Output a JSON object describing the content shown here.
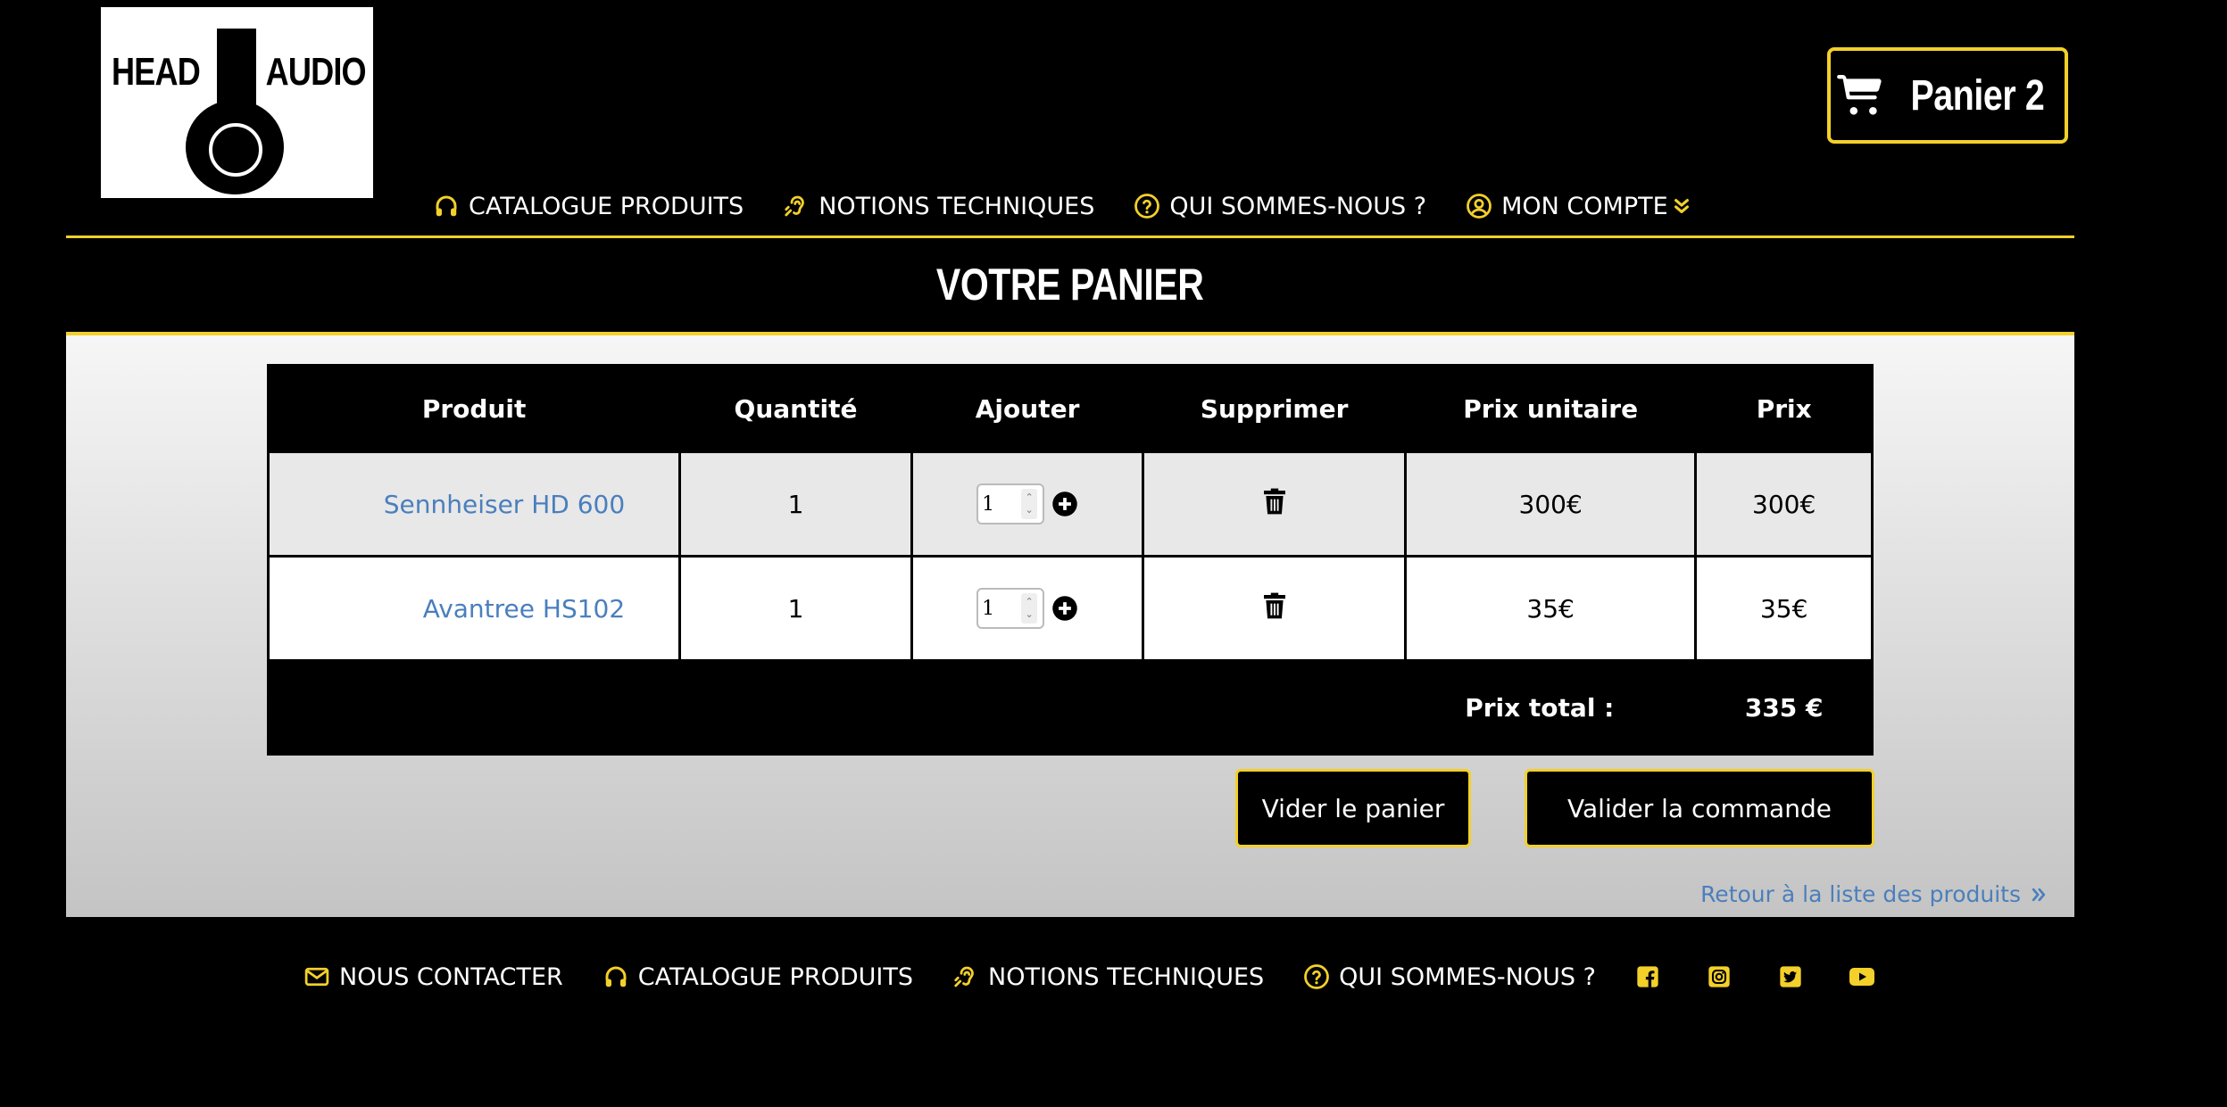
{
  "brand": {
    "word1": "HEAD",
    "word2": "AUDIO"
  },
  "cart_button": {
    "label": "Panier 2",
    "icon": "cart-icon"
  },
  "nav": [
    {
      "label": "CATALOGUE PRODUITS",
      "icon": "headphones-icon"
    },
    {
      "label": "NOTIONS TECHNIQUES",
      "icon": "ear-icon"
    },
    {
      "label": "QUI SOMMES-NOUS ?",
      "icon": "question-circle-icon"
    },
    {
      "label": "MON COMPTE",
      "icon": "user-circle-icon",
      "trailing_icon": "double-chevron-down-icon"
    }
  ],
  "page_title": "VOTRE PANIER",
  "table": {
    "headers": [
      "Produit",
      "Quantité",
      "Ajouter",
      "Supprimer",
      "Prix unitaire",
      "Prix"
    ],
    "rows": [
      {
        "product": "Sennheiser HD 600",
        "quantity": "1",
        "add_value": "1",
        "unit_price": "300€",
        "price": "300€"
      },
      {
        "product": "Avantree HS102",
        "quantity": "1",
        "add_value": "1",
        "unit_price": "35€",
        "price": "35€"
      }
    ],
    "total_label": "Prix total :",
    "total_value": "335 €"
  },
  "buttons": {
    "empty": "Vider le panier",
    "validate": "Valider la commande"
  },
  "back_link": "Retour à la liste des produits",
  "footer": [
    {
      "label": "NOUS CONTACTER",
      "icon": "envelope-icon"
    },
    {
      "label": "CATALOGUE PRODUITS",
      "icon": "headphones-icon"
    },
    {
      "label": "NOTIONS TECHNIQUES",
      "icon": "ear-icon"
    },
    {
      "label": "QUI SOMMES-NOUS ?",
      "icon": "question-circle-icon"
    }
  ],
  "social": [
    "facebook-icon",
    "instagram-icon",
    "twitter-icon",
    "youtube-icon"
  ],
  "colors": {
    "accent": "#f3d02a",
    "link": "#4a7fbd",
    "background": "#000000"
  }
}
